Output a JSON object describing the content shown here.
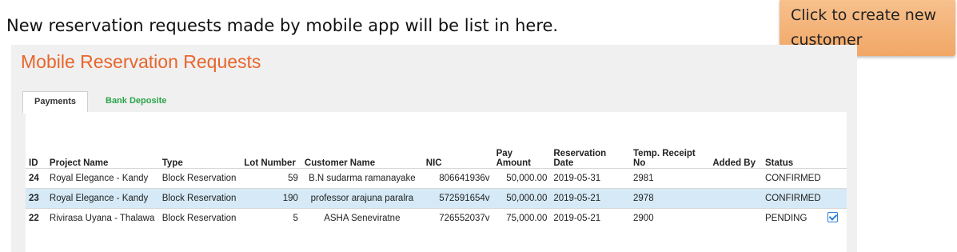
{
  "caption": "New reservation requests made by mobile app will be list in here.",
  "callout": {
    "line1": "Click to create new",
    "line2": "customer"
  },
  "panel": {
    "title": "Mobile Reservation Requests",
    "tabs": [
      {
        "label": "Payments",
        "active": true
      },
      {
        "label": "Bank Deposite",
        "active": false
      }
    ]
  },
  "table": {
    "headers": {
      "id": "ID",
      "project": "Project Name",
      "type": "Type",
      "lot": "Lot Number",
      "customer": "Customer Name",
      "nic": "NIC",
      "pay": "Pay Amount",
      "date": "Reservation Date",
      "receipt_line1": "Temp. Receipt",
      "receipt_line2": "No",
      "added_by": "Added By",
      "status": "Status"
    },
    "rows": [
      {
        "id": "24",
        "project": "Royal Elegance - Kandy",
        "type": "Block Reservation",
        "lot": "59",
        "customer": "B.N sudarma ramanayake",
        "nic": "806641936v",
        "pay": "50,000.00",
        "date": "2019-05-31",
        "receipt": "2981",
        "added_by": "",
        "status": "CONFIRMED",
        "action_icon": ""
      },
      {
        "id": "23",
        "project": "Royal Elegance - Kandy",
        "type": "Block Reservation",
        "lot": "190",
        "customer": "professor arajuna paralra",
        "nic": "572591654v",
        "pay": "50,000.00",
        "date": "2019-05-21",
        "receipt": "2978",
        "added_by": "",
        "status": "CONFIRMED",
        "action_icon": ""
      },
      {
        "id": "22",
        "project": "Rivirasa Uyana - Thalawa",
        "type": "Block Reservation",
        "lot": "5",
        "customer": "ASHA Seneviratne",
        "nic": "726552037v",
        "pay": "75,000.00",
        "date": "2019-05-21",
        "receipt": "2900",
        "added_by": "",
        "status": "PENDING",
        "action_icon": "edit-checkbox-icon"
      }
    ]
  },
  "colors": {
    "title": "#e8652b",
    "tab_inactive": "#2aa44a",
    "row_highlight": "#d5eaf6",
    "callout": "#f1a766",
    "icon": "#2a7fd0"
  }
}
